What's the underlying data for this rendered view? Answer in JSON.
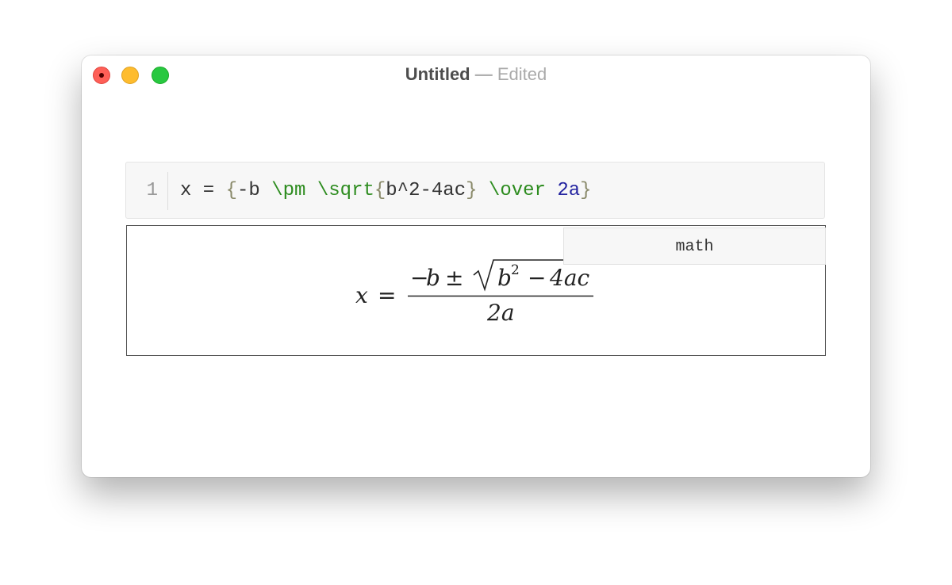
{
  "window": {
    "title": "Untitled",
    "separator": "—",
    "status": "Edited"
  },
  "editor": {
    "line_number": "1",
    "tokens": [
      {
        "text": "x = ",
        "kind": "plain"
      },
      {
        "text": "{",
        "kind": "bracket"
      },
      {
        "text": "-b ",
        "kind": "plain"
      },
      {
        "text": "\\pm",
        "kind": "keyword"
      },
      {
        "text": " ",
        "kind": "plain"
      },
      {
        "text": "\\sqrt",
        "kind": "keyword"
      },
      {
        "text": "{",
        "kind": "bracket"
      },
      {
        "text": "b^2-4ac",
        "kind": "plain"
      },
      {
        "text": "}",
        "kind": "bracket"
      },
      {
        "text": " ",
        "kind": "plain"
      },
      {
        "text": "\\over",
        "kind": "keyword"
      },
      {
        "text": " ",
        "kind": "plain"
      },
      {
        "text": "2a",
        "kind": "number"
      },
      {
        "text": "}",
        "kind": "bracket"
      }
    ]
  },
  "preview": {
    "language_tag": "math",
    "formula": {
      "lhs": "x",
      "equals": "=",
      "numerator_minus": "−",
      "numerator_b": "b",
      "plus_minus": "±",
      "radicand_b": "b",
      "exponent": "2",
      "radicand_minus": "−",
      "radicand_term": "4ac",
      "denominator": "2a"
    }
  },
  "colors": {
    "close": "#fe5f57",
    "minimize": "#febc2e",
    "zoom": "#28c840",
    "keyword": "#2d8c1f",
    "bracket": "#8a8a6a",
    "number": "#2424a0"
  }
}
